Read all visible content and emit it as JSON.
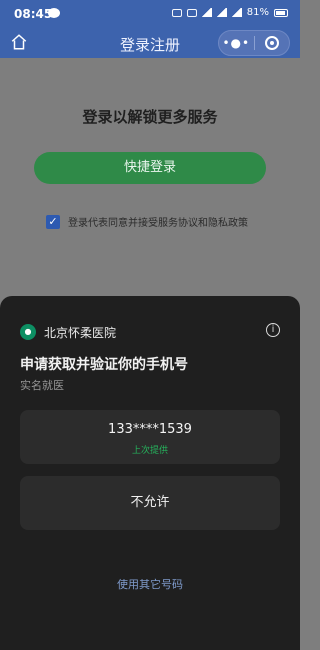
{
  "status_bar": {
    "time": "08:45",
    "battery": "81%"
  },
  "navbar": {
    "title": "登录注册",
    "menu_dots": "•●•"
  },
  "main": {
    "headline": "登录以解锁更多服务",
    "quick_login_label": "快捷登录",
    "agree_text": "登录代表同意并接受服务协议和隐私政策",
    "agree_checked": true
  },
  "sheet": {
    "hospital_name": "北京怀柔医院",
    "info_icon": "i",
    "request_title": "申请获取并验证你的手机号",
    "request_subtitle": "实名就医",
    "phone_number": "133****1539",
    "last_used_label": "上次提供",
    "deny_label": "不允许",
    "use_other_label": "使用其它号码"
  },
  "colors": {
    "primary": "#3d63ad",
    "green": "#2f8a48",
    "sheet_bg": "#1f1f1f"
  }
}
